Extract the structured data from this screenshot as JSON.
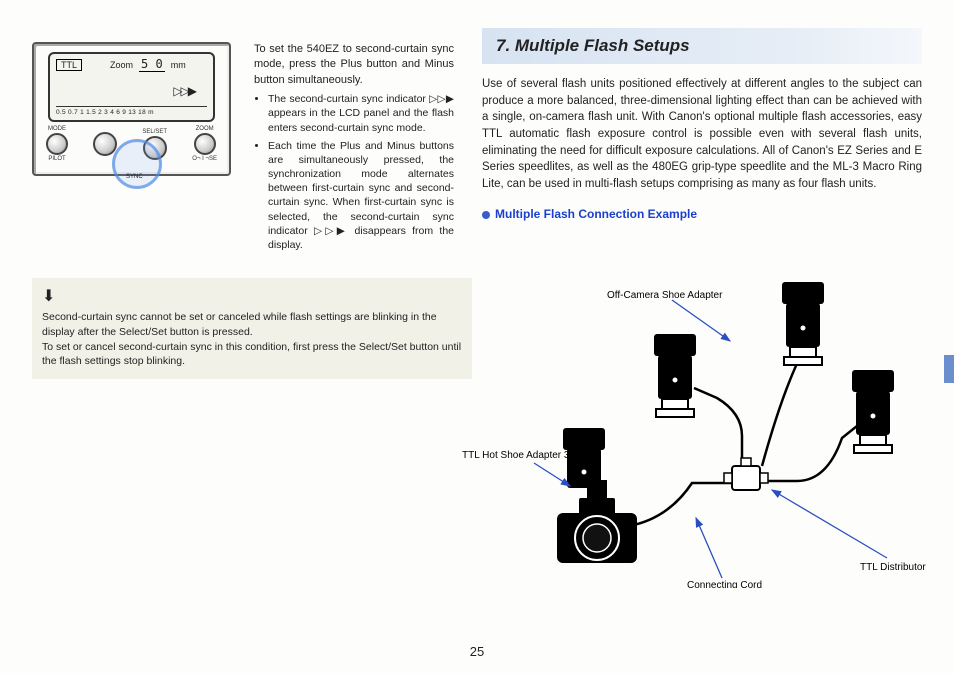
{
  "lcd": {
    "ttl": "TTL",
    "zoom_label": "Zoom",
    "zoom_value": "5 0",
    "zoom_unit": "mm",
    "sync_indicator": "▷▷▶",
    "scale": "0.5 0.7  1  1.5  2    3   4    6   9  13 18 m",
    "btn_mode": "MODE",
    "btn_pilot": "PILOT",
    "btn_selset": "SEL/SET",
    "btn_zoom": "ZOOM",
    "btn_sync": "SYNC",
    "btn_power": "O¬   I  ¬SE"
  },
  "left": {
    "intro": "To set the 540EZ to second-curtain sync mode, press the Plus button and Minus button simultaneously.",
    "bullet1": "The second-curtain sync indicator ▷▷▶ appears in the LCD panel and the flash enters second-curtain sync mode.",
    "bullet2": "Each time the Plus and Minus buttons are simultaneously pressed, the synchronization mode alternates between first-curtain sync and second-curtain sync. When first-curtain sync is selected, the second-curtain sync indicator ▷▷▶ disappears from the display."
  },
  "note": {
    "icon": "⬇",
    "line1": "Second-curtain sync cannot be set or canceled while flash settings are blinking in the display after the Select/Set button is pressed.",
    "line2": "To set or cancel second-curtain sync in this condition, first press the Select/Set button until the flash settings stop blinking."
  },
  "section": {
    "title": "7. Multiple Flash Setups",
    "para": "Use of several flash units positioned effectively at different angles to the subject can produce a more balanced, three-dimensional lighting effect than can be achieved with a single, on-camera flash unit. With Canon's optional multiple flash accessories, easy TTL automatic flash exposure control is possible even with several flash units, eliminating the need for difficult exposure calculations. All of Canon's EZ Series and E Series speedlites, as well as the 480EG grip-type speedlite and the ML-3 Macro Ring Lite, can be used in multi-flash setups comprising as many as four flash units.",
    "sub": "Multiple Flash Connection Example"
  },
  "diagram_labels": {
    "shoe_adapter": "Off-Camera Shoe Adapter",
    "hot_shoe": "TTL Hot Shoe Adapter 3",
    "distributor": "TTL Distributor",
    "cord": "Connecting Cord"
  },
  "page": "25"
}
